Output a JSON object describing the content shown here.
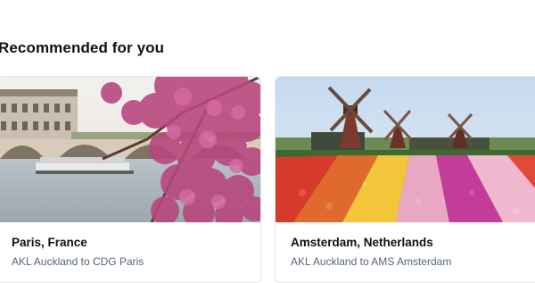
{
  "section": {
    "title": "Recommended for you"
  },
  "cards": [
    {
      "title": "Paris, France",
      "subtitle": "AKL Auckland to CDG Paris",
      "image": "paris-bridge-cherry-blossom"
    },
    {
      "title": "Amsterdam, Netherlands",
      "subtitle": "AKL Auckland to AMS Amsterdam",
      "image": "windmills-tulip-fields"
    }
  ],
  "colors": {
    "title_text": "#111111",
    "subtitle_text": "#556677",
    "card_border": "#e6e6e6"
  }
}
